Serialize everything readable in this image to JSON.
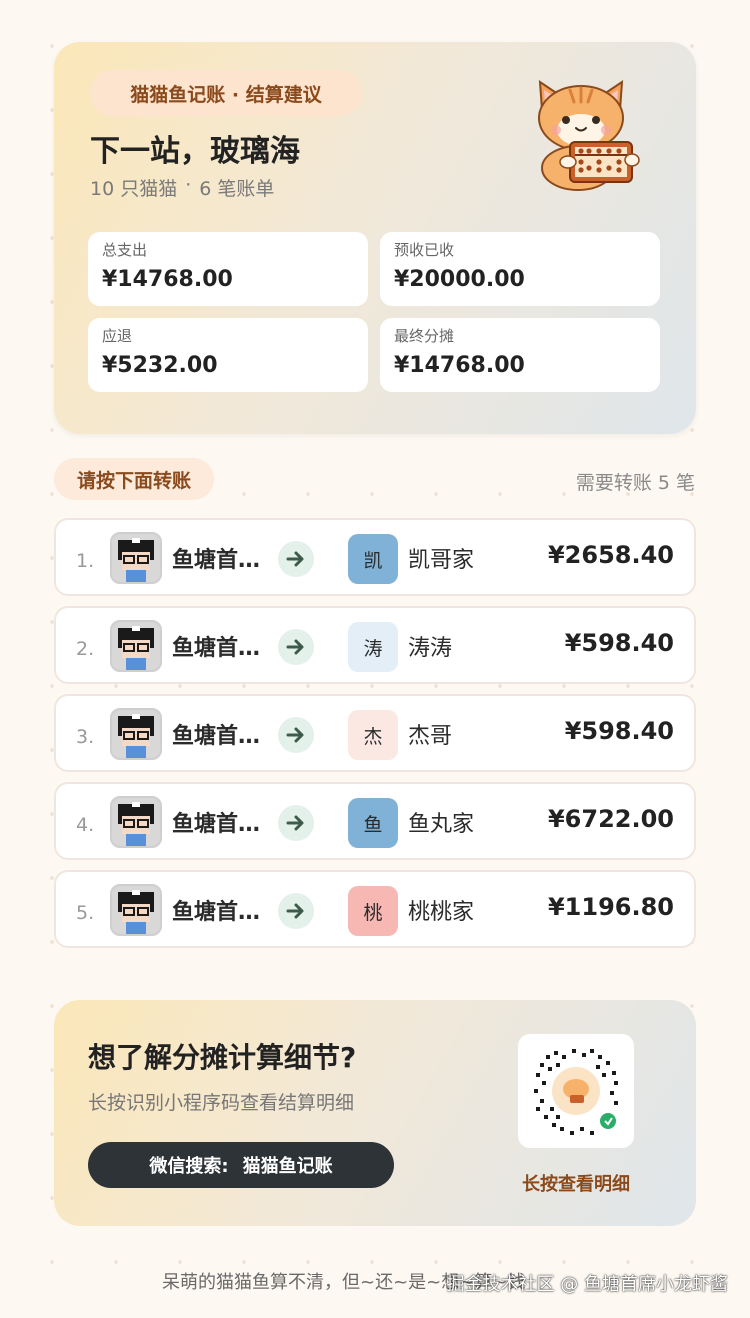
{
  "header": {
    "tag": "猫猫鱼记账 · 结算建议",
    "title": "下一站，玻璃海",
    "member_count": "10 只猫猫",
    "separator": "·",
    "bill_count": "6 笔账单"
  },
  "stats": [
    {
      "label": "总支出",
      "value": "¥14768.00"
    },
    {
      "label": "预收已收",
      "value": "¥20000.00"
    },
    {
      "label": "应退",
      "value": "¥5232.00"
    },
    {
      "label": "最终分摊",
      "value": "¥14768.00"
    }
  ],
  "transfers_section": {
    "title": "请按下面转账",
    "count": "需要转账 5 笔"
  },
  "transfers": [
    {
      "index": "1.",
      "from": "鱼塘首席小龙虾酱",
      "to_initial": "凯",
      "to": "凯哥家",
      "amount": "¥2658.40",
      "to_color": "#7fb2d6"
    },
    {
      "index": "2.",
      "from": "鱼塘首席小龙虾酱",
      "to_initial": "涛",
      "to": "涛涛",
      "amount": "¥598.40",
      "to_color": "#e4eef7"
    },
    {
      "index": "3.",
      "from": "鱼塘首席小龙虾酱",
      "to_initial": "杰",
      "to": "杰哥",
      "amount": "¥598.40",
      "to_color": "#fbe8e2"
    },
    {
      "index": "4.",
      "from": "鱼塘首席小龙虾酱",
      "to_initial": "鱼",
      "to": "鱼丸家",
      "amount": "¥6722.00",
      "to_color": "#7fb2d6"
    },
    {
      "index": "5.",
      "from": "鱼塘首席小龙虾酱",
      "to_initial": "桃",
      "to": "桃桃家",
      "amount": "¥1196.80",
      "to_color": "#f7b7b2"
    }
  ],
  "promo": {
    "title": "想了解分摊计算细节?",
    "subtitle": "长按识别小程序码查看结算明细",
    "search_prefix": "微信搜索:",
    "search_name": "猫猫鱼记账",
    "qr_caption": "长按查看明细"
  },
  "footer": {
    "slogan": "呆萌的猫猫鱼算不清，但~还~是~想~算~钱",
    "watermark": "掘金技术社区 @ 鱼塘首席小龙虾酱"
  }
}
